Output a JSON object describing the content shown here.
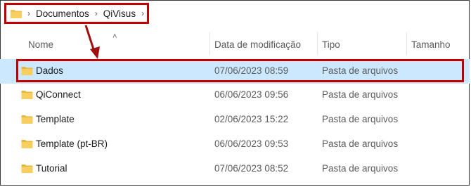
{
  "breadcrumb": {
    "items": [
      "Documentos",
      "QiVisus"
    ],
    "separator": "›"
  },
  "columns": {
    "name": "Nome",
    "modified": "Data de modificação",
    "type": "Tipo",
    "size": "Tamanho"
  },
  "rows": [
    {
      "name": "Dados",
      "modified": "07/06/2023 08:59",
      "type": "Pasta de arquivos",
      "selected": true
    },
    {
      "name": "QiConnect",
      "modified": "06/06/2023 09:56",
      "type": "Pasta de arquivos"
    },
    {
      "name": "Template",
      "modified": "02/06/2023 15:22",
      "type": "Pasta de arquivos"
    },
    {
      "name": "Template (pt-BR)",
      "modified": "06/06/2023 09:53",
      "type": "Pasta de arquivos"
    },
    {
      "name": "Tutorial",
      "modified": "07/06/2023 08:52",
      "type": "Pasta de arquivos"
    }
  ],
  "colors": {
    "highlight": "#c00000",
    "selection": "#cce8ff",
    "folder": "#f2c24f"
  }
}
